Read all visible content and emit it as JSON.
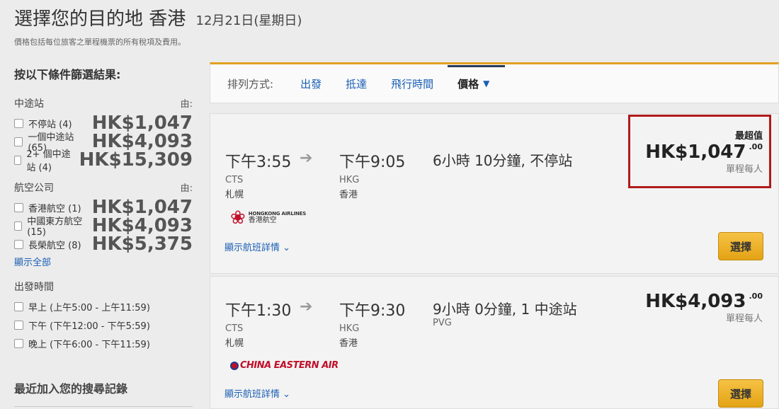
{
  "header": {
    "title": "選擇您的目的地 香港",
    "date": "12月21日(星期日)",
    "subtitle": "價格包括每位旅客之單程機票的所有稅項及費用。"
  },
  "sidebar": {
    "heading": "按以下條件篩選結果:",
    "stops": {
      "title": "中途站",
      "from_label": "由:",
      "options": [
        {
          "label": "不停站 (4)",
          "price": "HK$1,047"
        },
        {
          "label": "一個中途站 (65)",
          "price": "HK$4,093"
        },
        {
          "label": "2+ 個中途站 (4)",
          "price": "HK$15,309"
        }
      ]
    },
    "airlines": {
      "title": "航空公司",
      "from_label": "由:",
      "options": [
        {
          "label": "香港航空 (1)",
          "price": "HK$1,047"
        },
        {
          "label": "中國東方航空 (15)",
          "price": "HK$4,093"
        },
        {
          "label": "長榮航空 (8)",
          "price": "HK$5,375"
        }
      ],
      "show_all": "顯示全部"
    },
    "departure": {
      "title": "出發時間",
      "options": [
        {
          "label": "早上 (上午5:00 - 上午11:59)"
        },
        {
          "label": "下午 (下午12:00 - 下午5:59)"
        },
        {
          "label": "晚上 (下午6:00 - 下午11:59)"
        }
      ]
    },
    "recent": "最近加入您的搜尋記錄"
  },
  "sortbar": {
    "label": "排列方式:",
    "options": [
      "出發",
      "抵達",
      "飛行時間"
    ],
    "active": "價格"
  },
  "flights": [
    {
      "depart_time": "下午3:55",
      "depart_code": "CTS",
      "depart_city": "札幌",
      "arrive_time": "下午9:05",
      "arrive_code": "HKG",
      "arrive_city": "香港",
      "duration": "6小時 10分鐘, 不停站",
      "via": "",
      "airline_logo_en": "HONGKONG AIRLINES",
      "airline_logo_zh": "香港航空",
      "details_link": "顯示航班詳情",
      "badge": "最超值",
      "price": "HK$1,047",
      "cents": ".00",
      "per": "單程每人",
      "select": "選擇"
    },
    {
      "depart_time": "下午1:30",
      "depart_code": "CTS",
      "depart_city": "札幌",
      "arrive_time": "下午9:30",
      "arrive_code": "HKG",
      "arrive_city": "香港",
      "duration": "9小時 0分鐘, 1 中途站",
      "via": "PVG",
      "airline_logo_en": "CHINA EASTERN AIR",
      "details_link": "顯示航班詳情",
      "price": "HK$4,093",
      "cents": ".00",
      "per": "單程每人",
      "select": "選擇"
    }
  ],
  "icons": {
    "arrow": "arrow-right-icon",
    "chevron": "chevron-down-icon",
    "checkbox": "checkbox-icon"
  },
  "colors": {
    "link": "#1a5fb4",
    "accent": "#e3a315",
    "highlight": "#b01a1a"
  }
}
